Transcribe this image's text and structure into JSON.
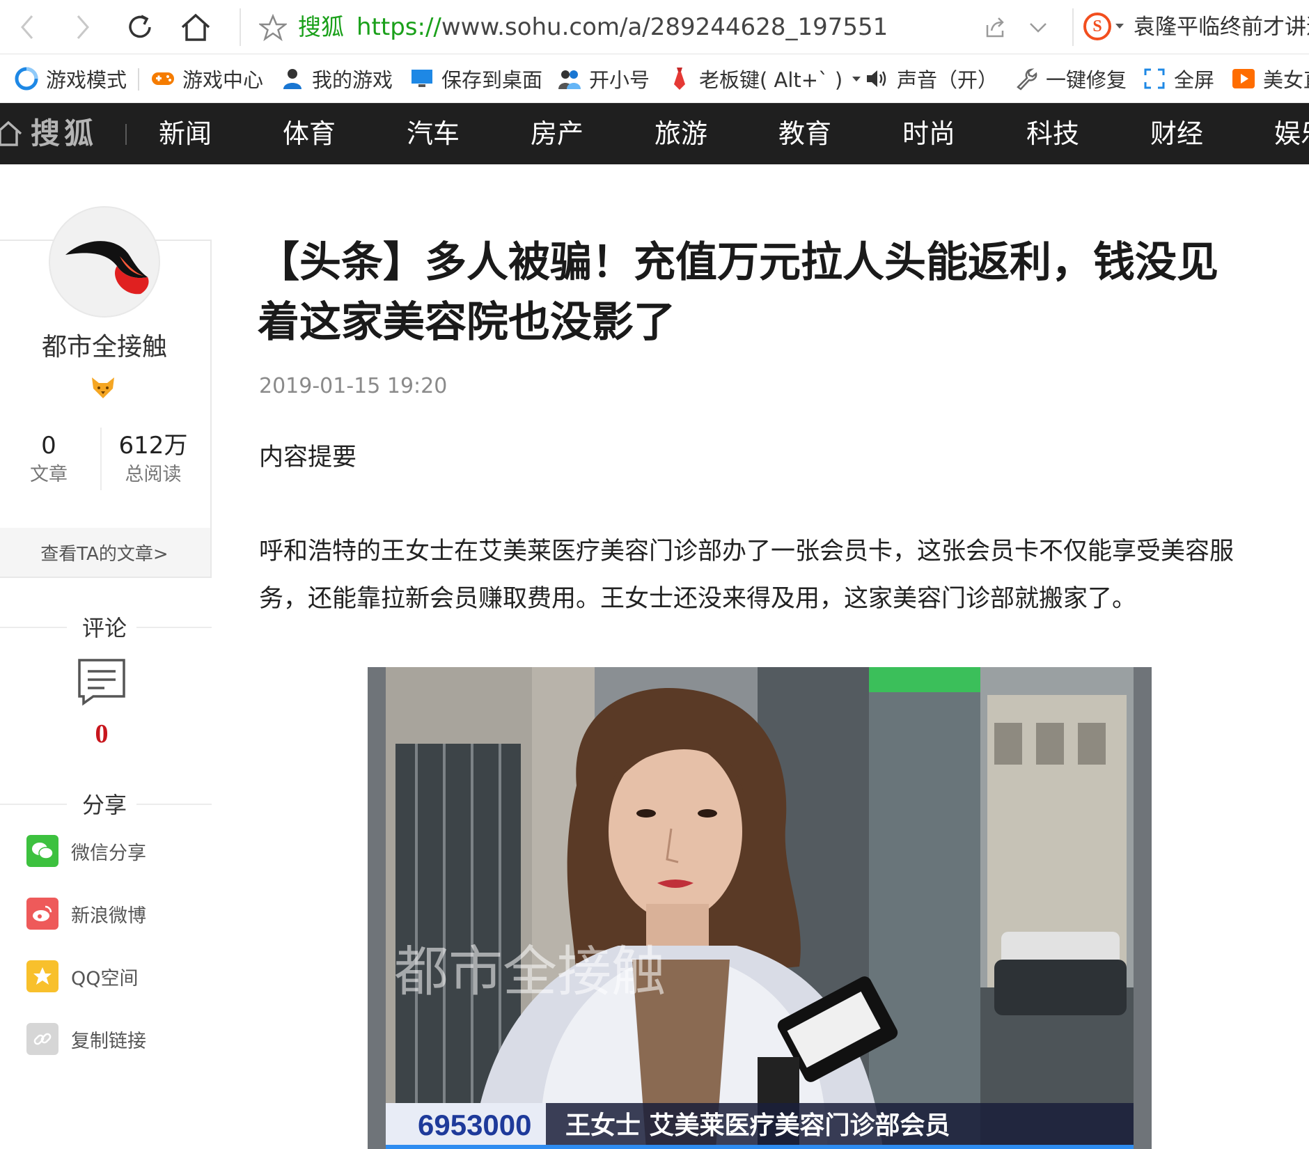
{
  "browser": {
    "address_site": "搜狐",
    "url_proto": "https://",
    "url_rest": "www.sohu.com/a/289244628_197551",
    "hot_news": "袁隆平临终前才讲道"
  },
  "bookmarks": [
    {
      "label": "游戏模式",
      "icon": "game-mode-icon",
      "color": "#1e88e5"
    },
    {
      "label": "游戏中心",
      "icon": "gamepad-icon",
      "color": "#f57c00"
    },
    {
      "label": "我的游戏",
      "icon": "user-icon",
      "color": "#1976d2"
    },
    {
      "label": "保存到桌面",
      "icon": "monitor-icon",
      "color": "#1e88e5"
    },
    {
      "label": "开小号",
      "icon": "users-icon",
      "color": "#1976d2"
    },
    {
      "label": "老板键( Alt+` )",
      "icon": "necktie-icon",
      "color": "#e53935"
    },
    {
      "label": "声音（开）",
      "icon": "speaker-icon",
      "color": "#333333"
    },
    {
      "label": "一键修复",
      "icon": "wrench-icon",
      "color": "#666666"
    },
    {
      "label": "全屏",
      "icon": "fullscreen-icon",
      "color": "#1e88e5"
    },
    {
      "label": "美女直",
      "icon": "play-icon",
      "color": "#ff6d00"
    }
  ],
  "site_nav": {
    "brand": "搜狐",
    "items": [
      "新闻",
      "体育",
      "汽车",
      "房产",
      "旅游",
      "教育",
      "时尚",
      "科技",
      "财经",
      "娱乐"
    ]
  },
  "author": {
    "name": "都市全接触",
    "articles_count": "0",
    "articles_label": "文章",
    "reads_count": "612万",
    "reads_label": "总阅读",
    "view_more": "查看TA的文章>"
  },
  "comments": {
    "title": "评论",
    "count": "0"
  },
  "share": {
    "title": "分享",
    "items": [
      {
        "label": "微信分享",
        "icon": "wechat-icon",
        "color": "#3dc13f"
      },
      {
        "label": "新浪微博",
        "icon": "weibo-icon",
        "color": "#ee5a5a"
      },
      {
        "label": "QQ空间",
        "icon": "qzone-star-icon",
        "color": "#f8c02c"
      },
      {
        "label": "复制链接",
        "icon": "link-icon",
        "color": "#d6d6d6"
      }
    ]
  },
  "article": {
    "headline": "【头条】多人被骗！充值万元拉人头能返利，钱没见着这家美容院也没影了",
    "published": "2019-01-15 19:20",
    "summary_title": "内容提要",
    "summary_text": "呼和浩特的王女士在艾美莱医疗美容门诊部办了一张会员卡，这张会员卡不仅能享受美容服务，还能靠拉新会员赚取费用。王女士还没来得及用，这家美容门诊部就搬家了。"
  },
  "photo": {
    "watermark": "都市全接触",
    "phone": "6953000",
    "caption": "王女士 艾美莱医疗美容门诊部会员"
  }
}
